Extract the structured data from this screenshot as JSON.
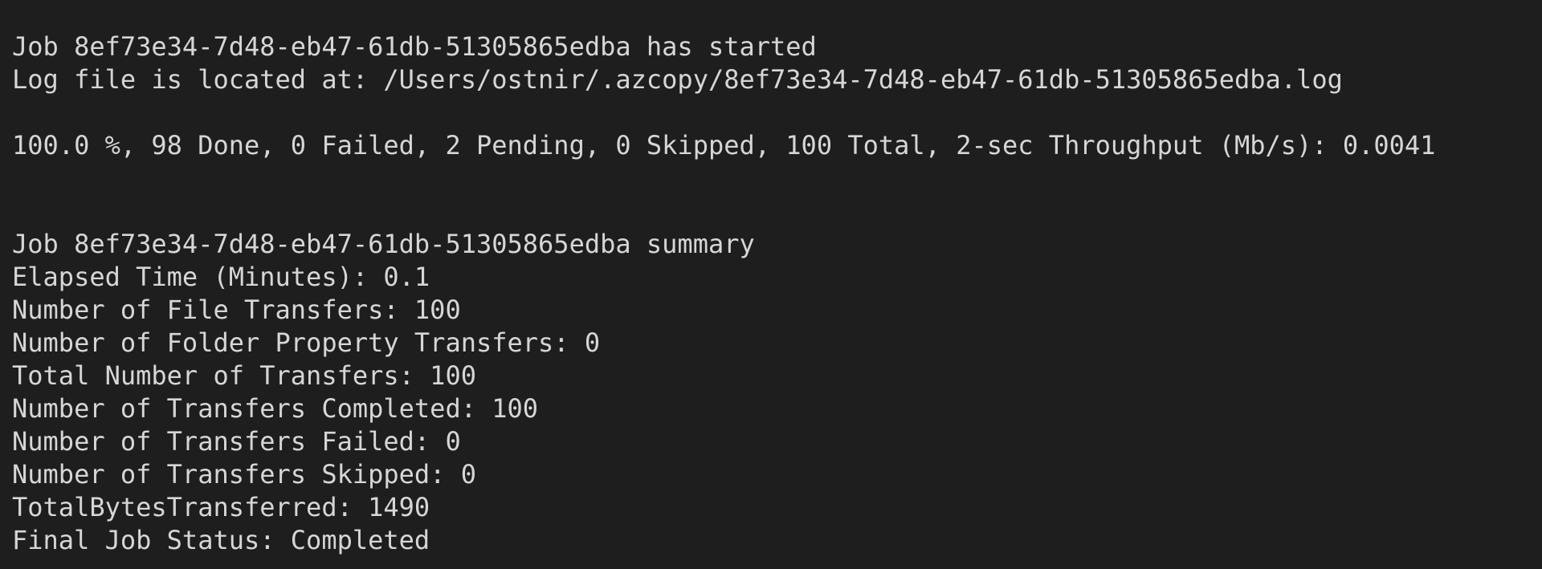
{
  "terminal": {
    "lines": [
      "Job 8ef73e34-7d48-eb47-61db-51305865edba has started",
      "Log file is located at: /Users/ostnir/.azcopy/8ef73e34-7d48-eb47-61db-51305865edba.log",
      "",
      "100.0 %, 98 Done, 0 Failed, 2 Pending, 0 Skipped, 100 Total, 2-sec Throughput (Mb/s): 0.0041",
      "",
      "",
      "Job 8ef73e34-7d48-eb47-61db-51305865edba summary",
      "Elapsed Time (Minutes): 0.1",
      "Number of File Transfers: 100",
      "Number of Folder Property Transfers: 0",
      "Total Number of Transfers: 100",
      "Number of Transfers Completed: 100",
      "Number of Transfers Failed: 0",
      "Number of Transfers Skipped: 0",
      "TotalBytesTransferred: 1490",
      "Final Job Status: Completed"
    ]
  },
  "colors": {
    "background": "#1e1e1e",
    "text": "#d6d6d6"
  }
}
